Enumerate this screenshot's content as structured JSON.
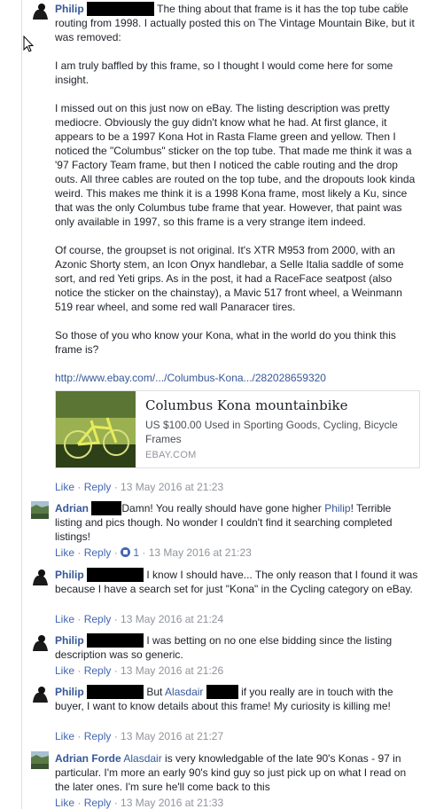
{
  "close_label": "×",
  "post": {
    "author": "Philip",
    "intro": "The thing about that frame is it has the top tube cable routing from 1998. I actually posted this on The Vintage Mountain Bike, but it was removed:",
    "paragraphs": [
      "I am truly baffled by this frame, so I thought I would come here for some insight.",
      "I missed out on this just now on eBay. The listing description was pretty mediocre. Obviously the guy didn't know what he had. At first glance, it appears to be a 1997 Kona Hot in Rasta Flame green and yellow. Then I noticed the \"Columbus\" sticker on the top tube. That made me think it was a '97 Factory Team frame, but then I noticed the cable routing and the drop outs. All three cables are routed on the top tube, and the dropouts look kinda weird. This makes me think it is a 1998 Kona frame, most likely a Ku, since that was the only Columbus tube frame that year. However, that paint was only available in 1997, so this frame is a very strange item indeed.",
      "Of course, the groupset is not original. It's XTR M953 from 2000, with an Azonic Shorty stem, an Icon Onyx handlebar, a Selle Italia saddle of some sort, and red Yeti grips. As in the post, it had a RaceFace seatpost (also notice the sticker on the chainstay), a Mavic 517 front wheel, a Weinmann 519 rear wheel, and some red wall Panaracer tires.",
      "So those of you who know your Kona, what in the world do you think this frame is?"
    ],
    "link": "http://www.ebay.com/.../Columbus-Kona.../282028659320",
    "share": {
      "title": "Columbus Kona mountainbike",
      "description": "US $100.00 Used in Sporting Goods, Cycling, Bicycle Frames",
      "domain": "EBAY.COM"
    },
    "like": "Like",
    "reply": "Reply",
    "timestamp": "13 May 2016 at 21:23"
  },
  "replies": [
    {
      "author": "Adrian",
      "text": "Damn! You really should have gone higher",
      "mention": "Philip",
      "text2": "! Terrible listing and pics though. No wonder I couldn't find it searching completed listings!",
      "like": "Like",
      "reply": "Reply",
      "reactions": "1",
      "timestamp": "13 May 2016 at 21:23"
    },
    {
      "author": "Philip",
      "text": "I know I should have... The only reason that I found it was because I have a search set for just \"Kona\" in the Cycling category on eBay.",
      "like": "Like",
      "reply": "Reply",
      "timestamp": "13 May 2016 at 21:24"
    },
    {
      "author": "Philip",
      "text": "I was betting on no one else bidding since the listing description was so generic.",
      "like": "Like",
      "reply": "Reply",
      "timestamp": "13 May 2016 at 21:26"
    },
    {
      "author": "Philip",
      "text": "But",
      "mention": "Alasdair",
      "text2": "if you really are in touch with the buyer, I want to know details about this frame! My curiosity is killing me!",
      "like": "Like",
      "reply": "Reply",
      "timestamp": "13 May 2016 at 21:27"
    },
    {
      "author": "Adrian Forde",
      "mention": "Alasdair",
      "text2": "is very knowledgable of the late 90's Konas - 97 in particular. I'm more an early 90's kind guy so just pick up on what I read on the later ones. I'm sure he'll come back to this",
      "like": "Like",
      "reply": "Reply",
      "timestamp": "13 May 2016 at 21:33"
    }
  ],
  "separator": " · "
}
